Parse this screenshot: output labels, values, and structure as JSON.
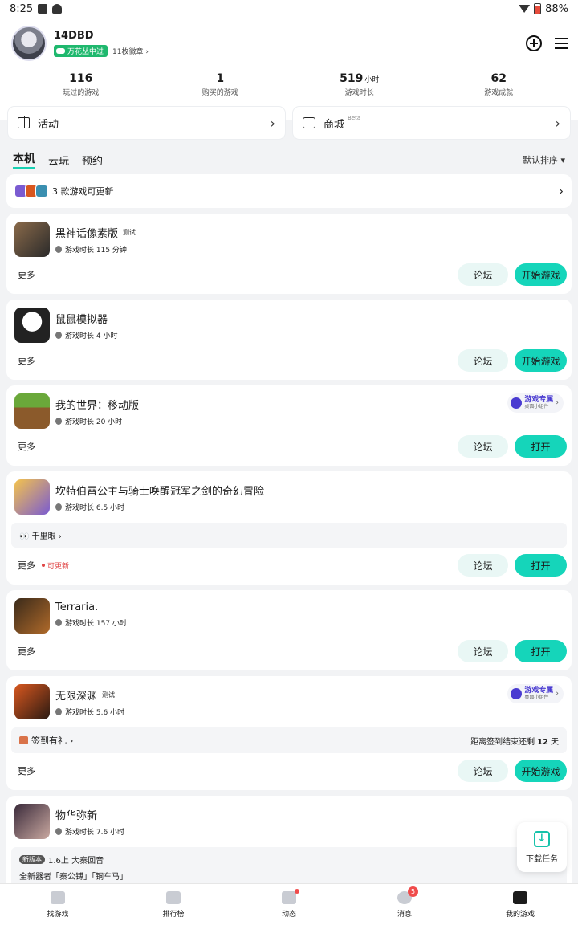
{
  "status_bar": {
    "time": "8:25",
    "battery": "88%"
  },
  "profile": {
    "username": "14DBD",
    "tag": "万花丛中过",
    "badge_count": "11枚徽章 ›"
  },
  "stats": [
    {
      "value": "116",
      "unit": "",
      "label": "玩过的游戏"
    },
    {
      "value": "1",
      "unit": "",
      "label": "购买的游戏"
    },
    {
      "value": "519",
      "unit": "小时",
      "label": "游戏时长"
    },
    {
      "value": "62",
      "unit": "",
      "label": "游戏成就"
    }
  ],
  "shortcuts": {
    "activity": "活动",
    "store": "商城",
    "store_beta": "Beta",
    "chev": "›"
  },
  "tabs": {
    "local": "本机",
    "cloud": "云玩",
    "reserve": "预约",
    "sort": "默认排序 ▾"
  },
  "updates_banner": {
    "text": "3 款游戏可更新",
    "chev": "›"
  },
  "common": {
    "more": "更多",
    "forum": "论坛",
    "widget_title": "游戏专属",
    "widget_sub": "桌面小组件",
    "widget_chev": "›"
  },
  "games": [
    {
      "name": "黑神话像素版",
      "tag": "测试",
      "time": "游戏时长 115 分钟",
      "action": "开始游戏",
      "icon_colors": [
        "#6a4a33",
        "#2a2a2a"
      ]
    },
    {
      "name": "鼠鼠模拟器",
      "tag": "",
      "time": "游戏时长 4 小时",
      "action": "开始游戏",
      "icon_colors": [
        "#ffffff",
        "#222222"
      ]
    },
    {
      "name": "我的世界：移动版",
      "tag": "",
      "time": "游戏时长 20 小时",
      "action": "打开",
      "icon_colors": [
        "#6aa83a",
        "#8b5a2b"
      ]
    },
    {
      "name": "坎特伯雷公主与骑士唤醒冠军之剑的奇幻冒险",
      "tag": "",
      "time": "游戏时长 6.5 小时",
      "action": "打开",
      "update_label": "可更新",
      "extra_text": "👀 千里眼 ›",
      "icon_colors": [
        "#f4c34d",
        "#7a5bd1"
      ]
    },
    {
      "name": "Terraria.",
      "tag": "",
      "time": "游戏时长 157 小时",
      "action": "打开",
      "icon_colors": [
        "#3a2a1a",
        "#b06a2a"
      ]
    },
    {
      "name": "无限深渊",
      "tag": "测试",
      "time": "游戏时长 5.6 小时",
      "action": "开始游戏",
      "checkin_title": "签到有礼",
      "checkin_chev": "›",
      "checkin_right_prefix": "距离签到结束还剩",
      "checkin_days": "12",
      "checkin_right_suffix": "天",
      "icon_colors": [
        "#d8571f",
        "#2b1a12"
      ]
    },
    {
      "name": "物华弥新",
      "tag": "",
      "time": "游戏时长 7.6 小时",
      "version_tag": "新版本",
      "version_title": "1.6上 大秦回音",
      "version_desc": "全新器者「秦公镈」「铜车马」",
      "icon_colors": [
        "#3b2b3b",
        "#c9a8a0"
      ]
    }
  ],
  "float_download": "下载任务",
  "bottom_nav": [
    {
      "label": "找游戏",
      "icon": "find-game-icon"
    },
    {
      "label": "排行榜",
      "icon": "ranking-icon"
    },
    {
      "label": "动态",
      "icon": "feed-icon"
    },
    {
      "label": "消息",
      "icon": "message-icon",
      "badge": "5"
    },
    {
      "label": "我的游戏",
      "icon": "my-games-icon"
    }
  ]
}
